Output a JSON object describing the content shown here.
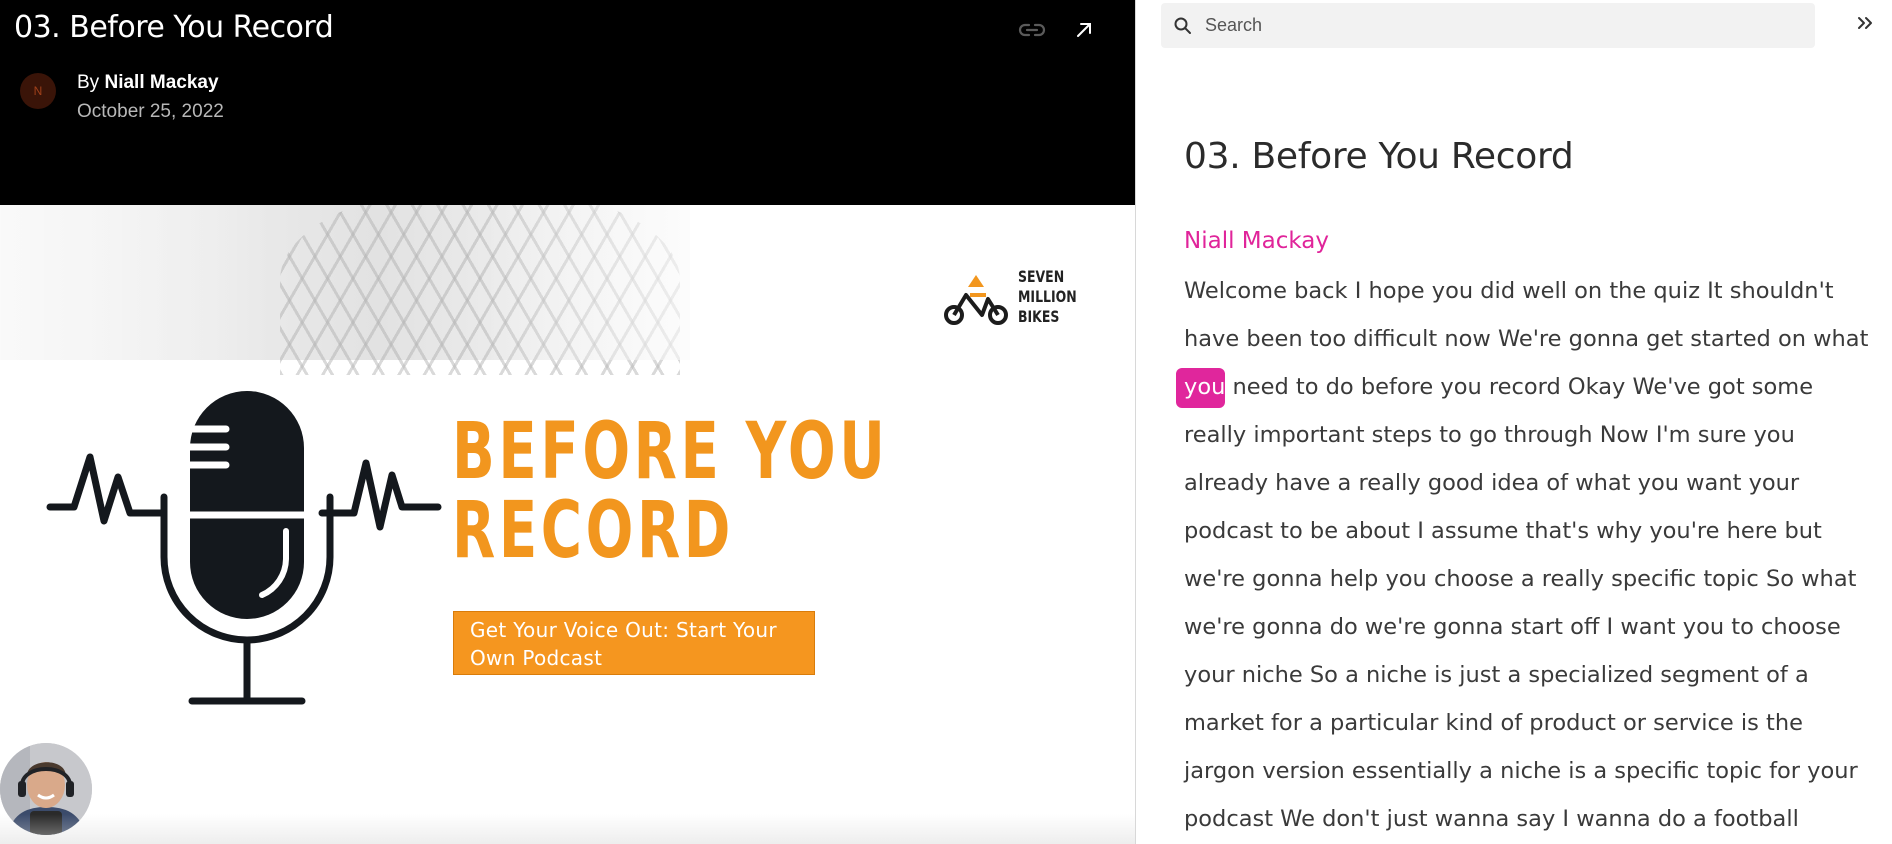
{
  "video": {
    "title": "03. Before You Record",
    "avatar_initial": "N",
    "byline_prefix": "By",
    "author": "Niall Mackay",
    "date": "October 25, 2022",
    "icons": {
      "link": "link-icon",
      "open": "open-in-new-icon"
    }
  },
  "slide": {
    "brand_name": "SEVEN\nMILLION\nBIKES",
    "title": "BEFORE YOU\nRECORD",
    "subtitle": "Get Your Voice Out: Start Your Own Podcast",
    "colors": {
      "accent": "#f2961e",
      "mic": "#14181d"
    }
  },
  "sidebar": {
    "search_placeholder": "Search",
    "collapse_icon": "double-chevron-right-icon",
    "title": "03. Before You Record",
    "speaker": "Niall Mackay",
    "highlight_color": "#e0269c",
    "lines": [
      "Welcome back I hope you did well on the quiz It shouldn't",
      "have been too difficult now We're gonna get started on what",
      "need to do before you record Okay We've got some",
      "really important steps to go through Now I'm sure you",
      "already have a really good idea of what you want your",
      "podcast to be about I assume that's why you're here but",
      "we're gonna help you choose a really specific topic So what",
      "we're gonna do we're gonna start off I want you to choose",
      "your niche So a niche is just a specialized segment of a",
      "market for a particular kind of product or service is the",
      "jargon version essentially a niche is a specific topic for your",
      "podcast We don't just wanna say I wanna do a football"
    ],
    "highlighted_word": "you"
  }
}
